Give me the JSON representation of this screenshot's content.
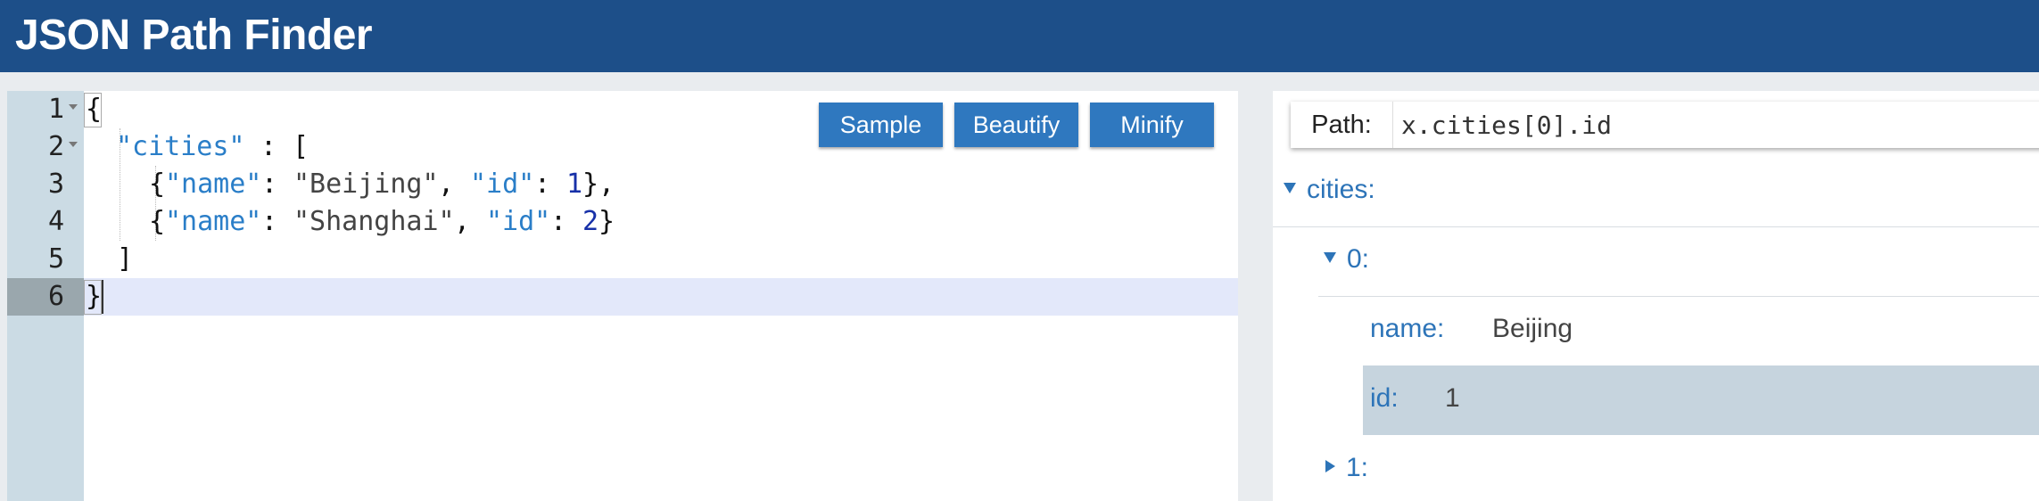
{
  "header": {
    "title": "JSON Path Finder"
  },
  "editor": {
    "line_numbers": [
      "1",
      "2",
      "3",
      "4",
      "5",
      "6"
    ],
    "active_line": 6,
    "lines": {
      "l1": {
        "brace": "{"
      },
      "l2": {
        "key": "\"cities\"",
        "colon": ":",
        "bracket": "["
      },
      "l3": {
        "open": "{",
        "k1": "\"name\"",
        "c1": ": ",
        "v1": "\"Beijing\"",
        "comma1": ", ",
        "k2": "\"id\"",
        "c2": ": ",
        "v2": "1",
        "close": "},"
      },
      "l4": {
        "open": "{",
        "k1": "\"name\"",
        "c1": ": ",
        "v1": "\"Shanghai\"",
        "comma1": ", ",
        "k2": "\"id\"",
        "c2": ": ",
        "v2": "2",
        "close": "}"
      },
      "l5": {
        "bracket": "]"
      },
      "l6": {
        "brace": "}"
      }
    },
    "buttons": {
      "sample": "Sample",
      "beautify": "Beautify",
      "minify": "Minify"
    }
  },
  "path": {
    "label": "Path:",
    "value": "x.cities[0].id"
  },
  "tree": {
    "cities": {
      "label": "cities:"
    },
    "item0": {
      "label": "0:"
    },
    "name": {
      "key": "name:",
      "value": "Beijing"
    },
    "id": {
      "key": "id:",
      "value": "1"
    },
    "item1": {
      "label": "1:"
    }
  },
  "colors": {
    "header": "#1d4f89",
    "button": "#2f78bf",
    "key": "#2a7ec8",
    "tree_text": "#2d74b8",
    "highlight": "#c6d4de"
  }
}
